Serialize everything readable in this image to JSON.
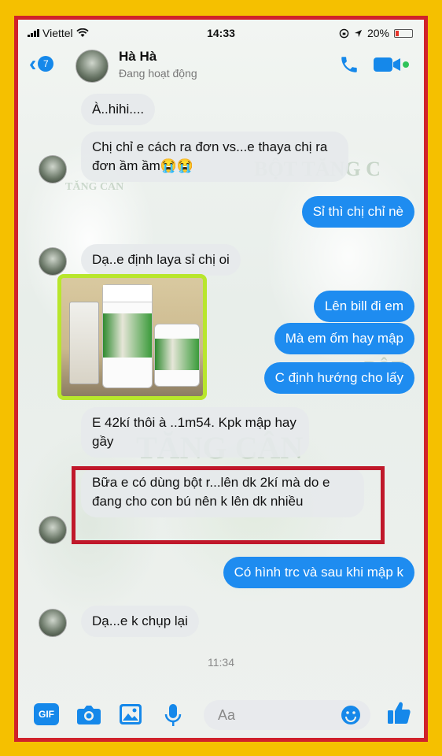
{
  "status_bar": {
    "carrier": "Viettel",
    "time": "14:33",
    "battery": "20%"
  },
  "header": {
    "back_count": "7",
    "contact_name": "Hà Hà",
    "presence": "Đang hoạt động"
  },
  "messages": [
    {
      "side": "in",
      "text": "À..hihi...."
    },
    {
      "side": "in",
      "text": "Chị chỉ e cách ra đơn vs...e thaya chị ra đơn ầm ầm😭😭"
    },
    {
      "side": "out",
      "text": "Sỉ thì chị chỉ nè"
    },
    {
      "side": "in",
      "text": "Dạ..e định laya sỉ chị oi"
    },
    {
      "side": "out",
      "text": "Lên bill đi em"
    },
    {
      "side": "out",
      "text": "Mà em ốm hay mập"
    },
    {
      "side": "out",
      "text": "C định hướng cho lấy"
    },
    {
      "side": "in",
      "text": "E 42kí thôi à ..1m54. Kpk mập hay gầy"
    },
    {
      "side": "in",
      "text": "Bữa e có dùng bột r...lên dk 2kí mà do e đang cho con bú nên k lên dk nhiều"
    },
    {
      "side": "out",
      "text": "Có hình trc và sau khi mập k"
    },
    {
      "side": "in",
      "text": "Dạ...e k chụp lại"
    }
  ],
  "time_separator": "11:34",
  "composer": {
    "placeholder": "Aa",
    "gif_label": "GIF"
  },
  "colors": {
    "border_outer": "#f5c000",
    "frame_border": "#d0222a",
    "accent": "#1588ea",
    "outgoing_bubble": "#1e8cf0",
    "incoming_bubble": "#e6e9ec",
    "image_border": "#b8e62c",
    "highlight_box": "#c0182a"
  },
  "icons": [
    "signal-icon",
    "wifi-icon",
    "lock-rotation-icon",
    "location-icon",
    "battery-icon",
    "back-chevron-icon",
    "phone-icon",
    "video-camera-icon",
    "gif-icon",
    "camera-icon",
    "gallery-icon",
    "microphone-icon",
    "emoji-icon",
    "like-icon"
  ]
}
